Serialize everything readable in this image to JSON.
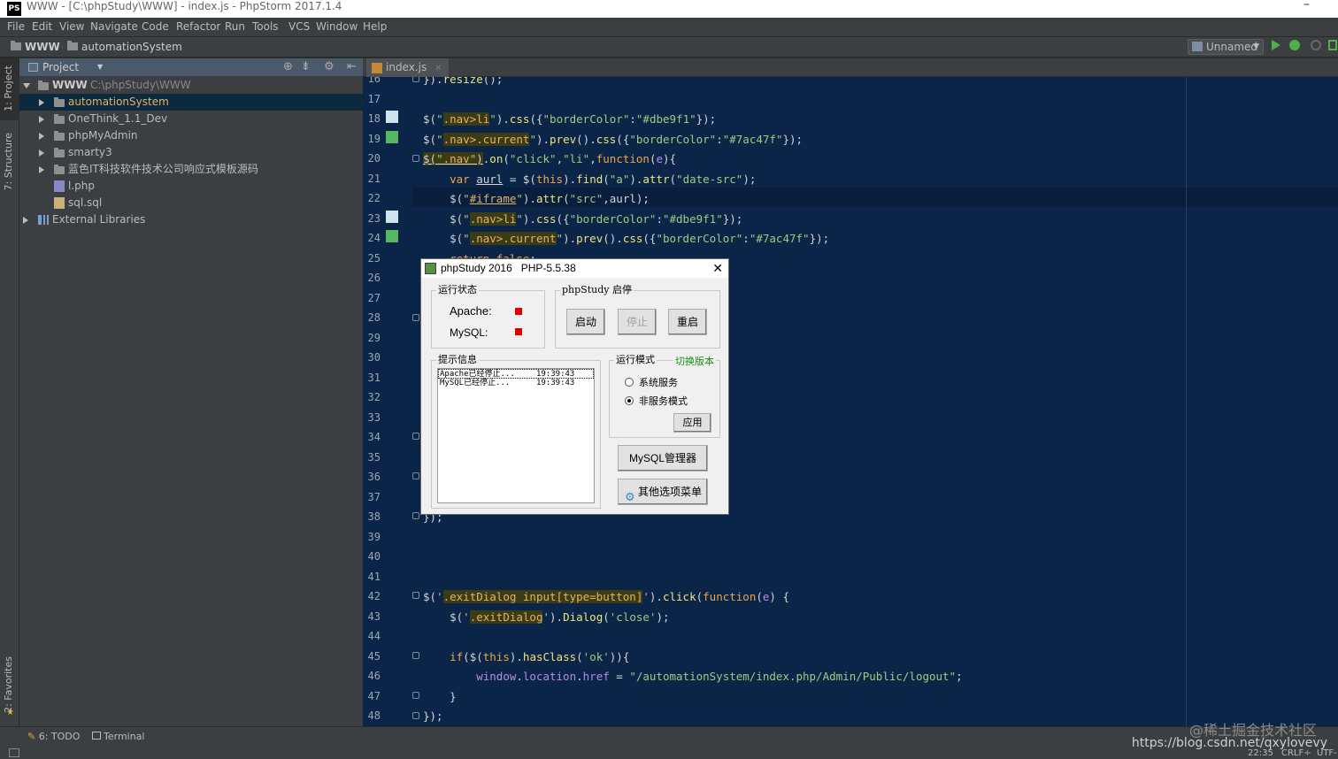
{
  "window": {
    "title": "WWW - [C:\\phpStudy\\WWW] - index.js - PhpStorm 2017.1.4",
    "app_icon": "PS"
  },
  "menu": [
    "File",
    "Edit",
    "View",
    "Navigate",
    "Code",
    "Refactor",
    "Run",
    "Tools",
    "VCS",
    "Window",
    "Help"
  ],
  "breadcrumb": {
    "root": "WWW",
    "child": "automationSystem"
  },
  "run_config": "Unnamed",
  "side_tabs": {
    "project": "1: Project",
    "structure": "7: Structure",
    "favorites": "2: Favorites"
  },
  "project": {
    "header": "Project",
    "root": {
      "name": "WWW",
      "path": "C:\\phpStudy\\WWW"
    },
    "items": [
      "automationSystem",
      "OneThink_1.1_Dev",
      "phpMyAdmin",
      "smarty3",
      "蓝色IT科技软件技术公司响应式模板源码"
    ],
    "files": [
      "l.php",
      "sql.sql"
    ],
    "libraries": "External Libraries"
  },
  "editor": {
    "tab": "index.js",
    "line_numbers": [
      "16",
      "17",
      "18",
      "19",
      "20",
      "21",
      "22",
      "23",
      "24",
      "25",
      "26",
      "27",
      "28",
      "29",
      "30",
      "31",
      "32",
      "33",
      "34",
      "35",
      "36",
      "37",
      "38",
      "39",
      "40",
      "41",
      "42",
      "43",
      "44",
      "45",
      "46",
      "47",
      "48"
    ]
  },
  "dialog": {
    "title": "phpStudy 2016   PHP-5.5.38",
    "status_group": "运行状态",
    "apache": "Apache:",
    "mysql": "MySQL:",
    "control_group": "phpStudy 启停",
    "start": "启动",
    "stop": "停止",
    "restart": "重启",
    "info_group": "提示信息",
    "log": [
      {
        "msg": "Apache已经停止...",
        "time": "19:39:43"
      },
      {
        "msg": "MySQL已经停止...",
        "time": "19:39:43"
      }
    ],
    "mode_group": "运行模式",
    "switch_version": "切换版本",
    "mode_service": "系统服务",
    "mode_nonservice": "非服务模式",
    "apply": "应用",
    "mysql_manager": "MySQL管理器",
    "other_menu": "其他选项菜单",
    "status_color": "#e00000"
  },
  "bottom": {
    "todo": "6: TODO",
    "terminal": "Terminal",
    "time": "22:35",
    "crlf": "CRLF÷",
    "enc": "UTF-"
  },
  "watermark": {
    "line1": "@稀土掘金技术社区",
    "line2": "https://blog.csdn.net/qxylovevy"
  }
}
